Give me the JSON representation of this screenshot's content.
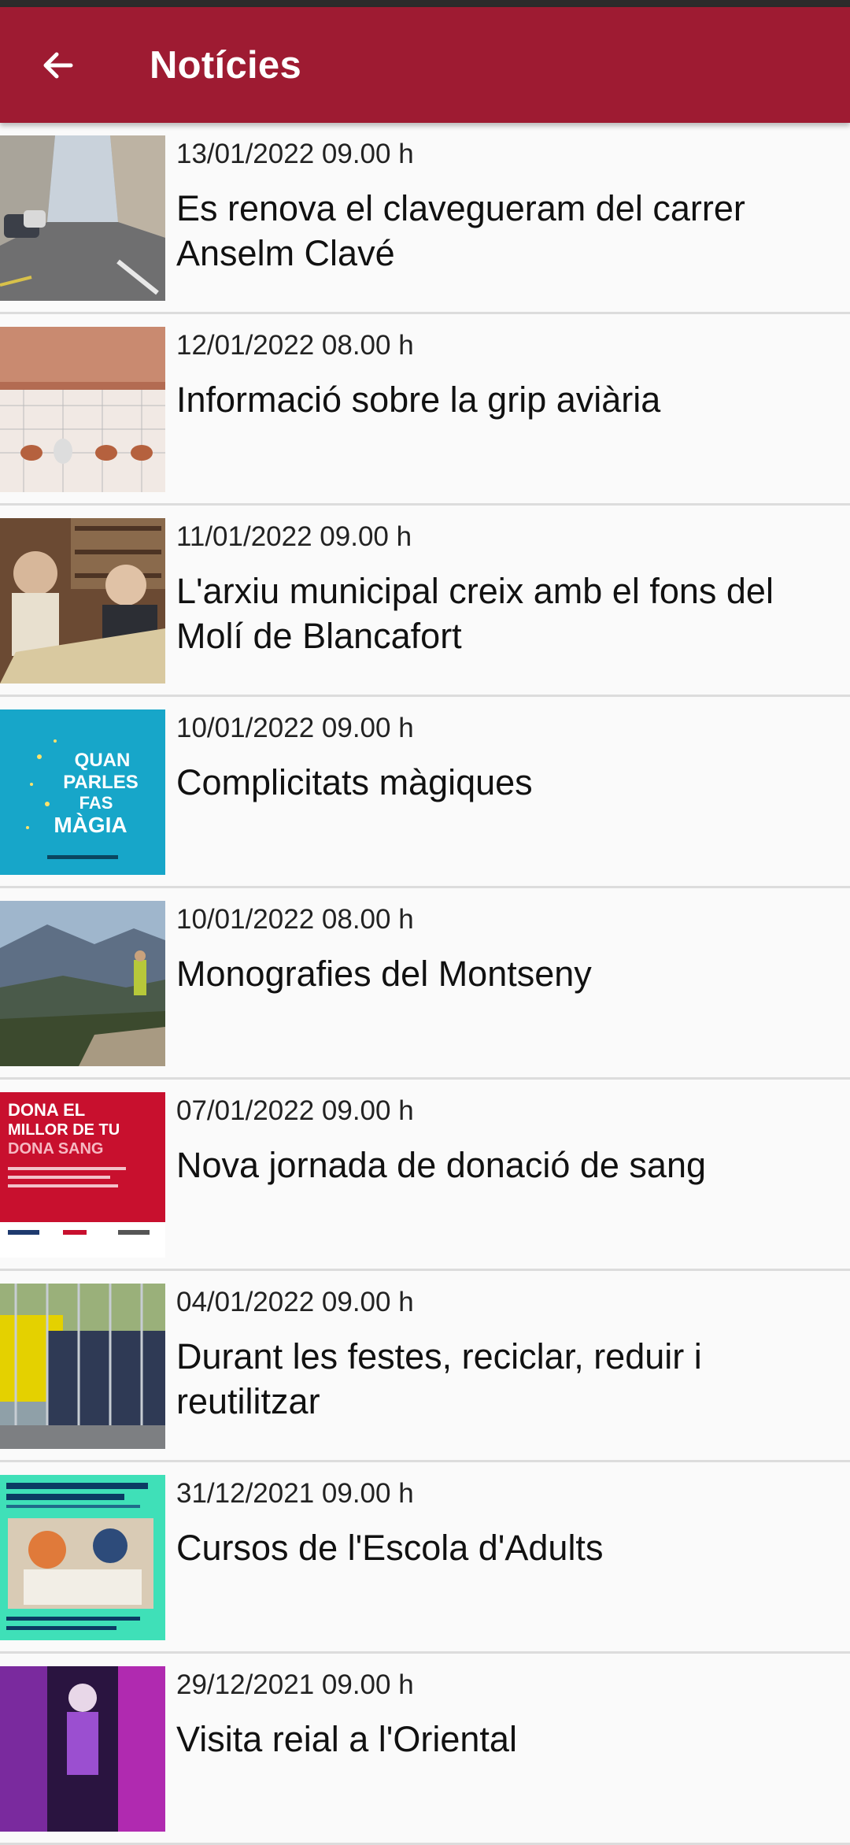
{
  "appbar": {
    "title": "Notícies",
    "back_icon": "arrow-left-icon",
    "color": "#9e1b32"
  },
  "news": [
    {
      "date": "13/01/2022 09.00 h",
      "title": "Es renova el clavegueram del carrer Anselm Clavé",
      "thumb": "street-photo"
    },
    {
      "date": "12/01/2022 08.00 h",
      "title": "Informació sobre la grip aviària",
      "thumb": "hens-illustration"
    },
    {
      "date": "11/01/2022 09.00 h",
      "title": "L'arxiu municipal creix amb el fons del Molí de Blancafort",
      "thumb": "archive-photo"
    },
    {
      "date": "10/01/2022 09.00 h",
      "title": "Complicitats màgiques",
      "thumb": "poster-quan-parles",
      "thumb_text": [
        "QUAN",
        "PARLES",
        "FAS",
        "MÀGIA"
      ]
    },
    {
      "date": "10/01/2022 08.00 h",
      "title": "Monografies del Montseny",
      "thumb": "mountain-photo"
    },
    {
      "date": "07/01/2022 09.00 h",
      "title": "Nova jornada de donació de sang",
      "thumb": "poster-dona-sang",
      "thumb_text": [
        "DONA EL",
        "MILLOR DE TU",
        "DONA SANG"
      ]
    },
    {
      "date": "04/01/2022 09.00 h",
      "title": "Durant les festes, reciclar, reduir i reutilitzar",
      "thumb": "recycling-photo"
    },
    {
      "date": "31/12/2021 09.00 h",
      "title": "Cursos de l'Escola d'Adults",
      "thumb": "adults-school-poster"
    },
    {
      "date": "29/12/2021 09.00 h",
      "title": "Visita reial a l'Oriental",
      "thumb": "stage-photo"
    }
  ]
}
